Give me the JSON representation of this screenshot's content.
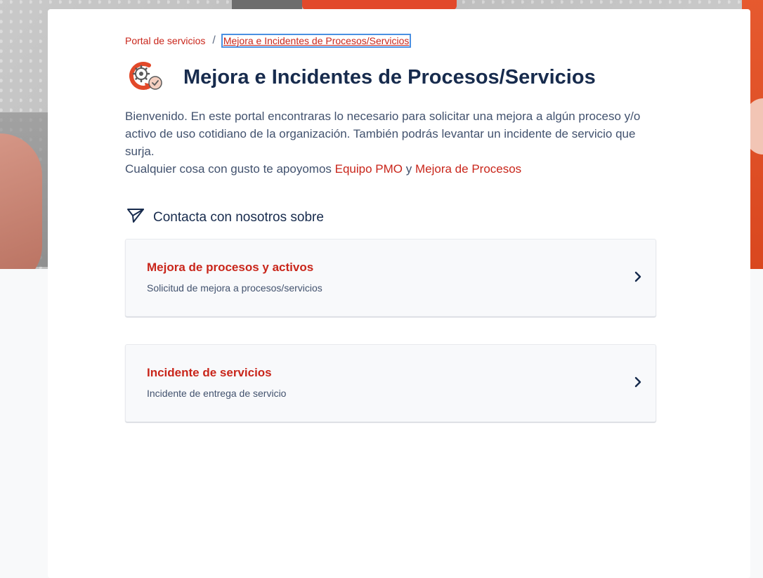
{
  "breadcrumb": {
    "home": "Portal de servicios",
    "separator": "/",
    "current": "Mejora e Incidentes de Procesos/Servicios"
  },
  "header": {
    "title": "Mejora e Incidentes de Procesos/Servicios",
    "icon": "gear-refresh-icon"
  },
  "intro": {
    "line1": "Bienvenido. En este portal encontraras lo necesario para solicitar una mejora a algún proceso y/o activo de uso cotidiano de la organización. También podrás levantar un incidente de servicio que surja.",
    "line2_prefix": "Cualquier cosa con gusto te apoyomos",
    "link1": "Equipo PMO",
    "connector": "y",
    "link2": "Mejora de Procesos"
  },
  "section": {
    "title": "Contacta con nosotros sobre",
    "icon": "send-icon"
  },
  "requests": [
    {
      "title": "Mejora de procesos y activos",
      "description": "Solicitud de mejora a procesos/servicios"
    },
    {
      "title": "Incidente de servicios",
      "description": "Incidente de entrega de servicio"
    }
  ],
  "colors": {
    "accent": "#c9261b",
    "heading": "#172b4d",
    "body": "#42526e",
    "focus": "#4a90e2"
  }
}
